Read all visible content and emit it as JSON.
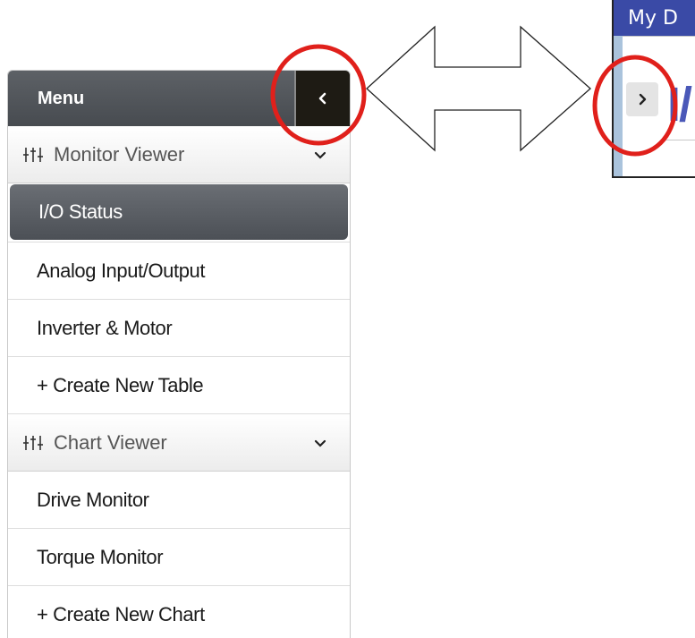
{
  "sidebar": {
    "header": {
      "title": "Menu",
      "collapse_icon": "chevron-left-icon"
    },
    "sections": [
      {
        "title": "Monitor Viewer",
        "icon": "sliders-icon",
        "chevron": "chevron-down-icon",
        "items": [
          "I/O Status",
          "Analog Input/Output",
          "Inverter & Motor",
          "+ Create New Table"
        ],
        "active_index": 0
      },
      {
        "title": "Chart Viewer",
        "icon": "sliders-icon",
        "chevron": "chevron-down-icon",
        "items": [
          "Drive Monitor",
          "Torque Monitor",
          "+ Create New Chart"
        ]
      }
    ]
  },
  "collapsed_view": {
    "title_bar": "My D",
    "heading_fragment": "I/",
    "expand_icon": "chevron-right-icon"
  },
  "annotation": {
    "highlight_color": "#e0201b",
    "arrow": "double-headed-arrow"
  },
  "colors": {
    "menu_header_bg": "#4f5359",
    "collapse_button_bg": "#1e1b14",
    "active_item_bg": "#5b5f65",
    "title_bar_bg": "#3a4aa6",
    "heading_color": "#4a58b8"
  }
}
